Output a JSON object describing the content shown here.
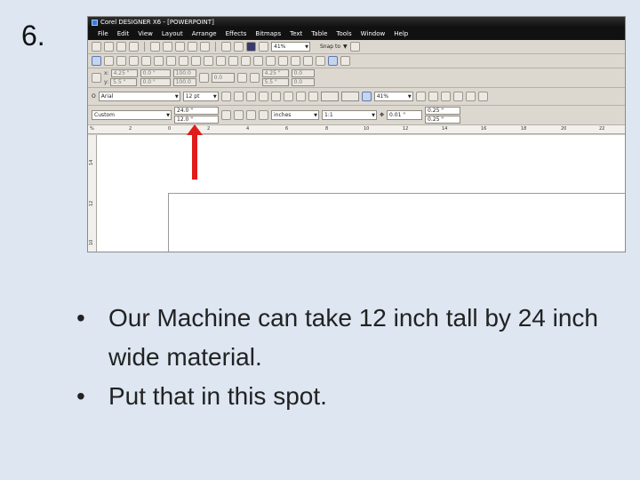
{
  "slide": {
    "number": "6."
  },
  "app": {
    "title": "Corel DESIGNER X6 - [POWERPOINT]",
    "menu": [
      "File",
      "Edit",
      "View",
      "Layout",
      "Arrange",
      "Effects",
      "Bitmaps",
      "Text",
      "Table",
      "Tools",
      "Window",
      "Help"
    ],
    "toolbar": {
      "zoom": "41%",
      "snap_to": "Snap to"
    },
    "props1": {
      "x": "4.25 \"",
      "y": "5.5 \"",
      "w": "0.0 \"",
      "h": "0.0 \"",
      "sx": "100.0",
      "sy": "100.0",
      "angle": "0.0",
      "x2": "4.25 \"",
      "y2": "5.5 \"",
      "w2": "0.0",
      "h2": "0.0"
    },
    "props2": {
      "font": "Arial",
      "size": "12 pt",
      "zoom": "41%"
    },
    "props3": {
      "preset": "Custom",
      "width": "24.0 \"",
      "height": "12.0 \"",
      "units": "inches",
      "scale": "1:1",
      "nudge": "0.01 \"",
      "dup_x": "0.25 \"",
      "dup_y": "0.25 \""
    },
    "ruler_h": [
      "%",
      "2",
      "0",
      "2",
      "4",
      "6",
      "8",
      "10",
      "12",
      "14",
      "16",
      "18",
      "20",
      "22"
    ],
    "ruler_v": [
      "14",
      "12",
      "10"
    ]
  },
  "annotation": {
    "color": "#e01b1b"
  },
  "bullets": [
    "Our Machine can take 12 inch tall by 24 inch wide material.",
    "Put that in this spot."
  ]
}
